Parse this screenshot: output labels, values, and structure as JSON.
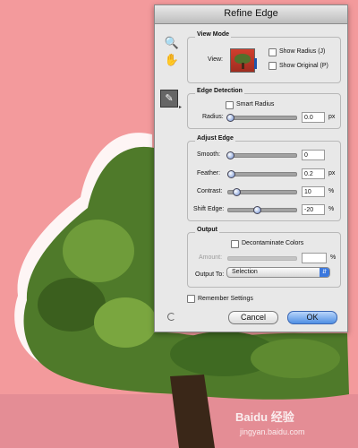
{
  "dialog": {
    "title": "Refine Edge",
    "view_mode": {
      "label": "View Mode",
      "view_label": "View:",
      "show_radius": "Show Radius (J)",
      "show_original": "Show Original (P)"
    },
    "edge_detection": {
      "label": "Edge Detection",
      "smart_radius": "Smart Radius",
      "radius_label": "Radius:",
      "radius_value": "0.0",
      "radius_unit": "px"
    },
    "adjust_edge": {
      "label": "Adjust Edge",
      "smooth_label": "Smooth:",
      "smooth_value": "0",
      "feather_label": "Feather:",
      "feather_value": "0.2",
      "feather_unit": "px",
      "contrast_label": "Contrast:",
      "contrast_value": "10",
      "contrast_unit": "%",
      "shift_label": "Shift Edge:",
      "shift_value": "-20",
      "shift_unit": "%"
    },
    "output": {
      "label": "Output",
      "decontaminate": "Decontaminate Colors",
      "amount_label": "Amount:",
      "amount_unit": "%",
      "output_to_label": "Output To:",
      "output_to_value": "Selection"
    },
    "remember": "Remember Settings",
    "cancel": "Cancel",
    "ok": "OK"
  },
  "watermark": {
    "line1": "Baidu 经验",
    "line2": "jingyan.baidu.com"
  },
  "icons": {
    "zoom": "zoom-icon",
    "hand": "hand-icon",
    "refine-brush": "refine-brush-icon"
  },
  "colors": {
    "background": "#f39a9c",
    "tree_dark": "#2d4a17",
    "tree_light": "#7aa63f",
    "accent": "#3b78de"
  }
}
